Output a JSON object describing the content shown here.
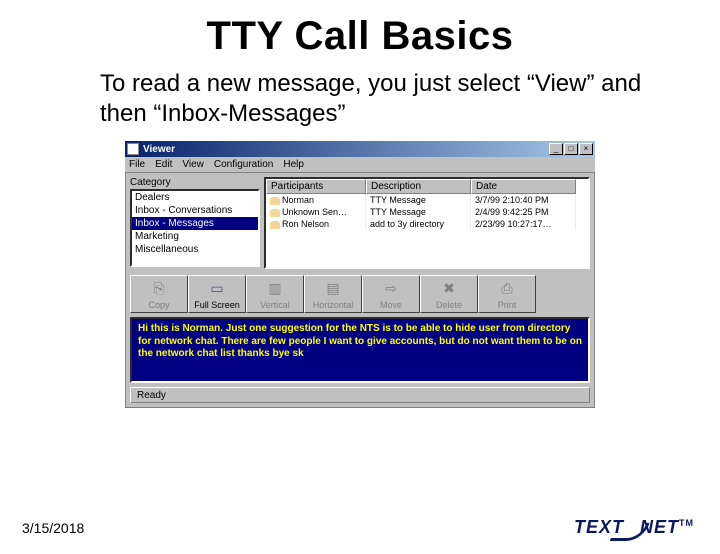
{
  "slide": {
    "title": "TTY Call Basics",
    "body": "To read a new message, you just select “View” and then “Inbox-Messages”"
  },
  "window": {
    "title": "Viewer",
    "controls": {
      "min": "_",
      "max": "□",
      "close": "×"
    }
  },
  "menu": {
    "items": [
      "File",
      "Edit",
      "View",
      "Configuration",
      "Help"
    ]
  },
  "category": {
    "label": "Category",
    "items": [
      {
        "label": "Dealers",
        "selected": false
      },
      {
        "label": "Inbox - Conversations",
        "selected": false
      },
      {
        "label": "Inbox - Messages",
        "selected": true
      },
      {
        "label": "Marketing",
        "selected": false
      },
      {
        "label": "Miscellaneous",
        "selected": false
      }
    ]
  },
  "grid": {
    "headers": {
      "participants": "Participants",
      "description": "Description",
      "date": "Date"
    },
    "rows": [
      {
        "participant": "Norman",
        "description": "TTY Message",
        "date": "3/7/99 2:10:40 PM"
      },
      {
        "participant": "Unknown Sen…",
        "description": "TTY Message",
        "date": "2/4/99 9:42:25 PM"
      },
      {
        "participant": "Ron Nelson",
        "description": "add to 3y directory",
        "date": "2/23/99 10:27:17…"
      }
    ]
  },
  "toolbar": {
    "buttons": [
      {
        "label": "Copy",
        "glyph": "⎘",
        "enabled": false
      },
      {
        "label": "Full Screen",
        "glyph": "▭",
        "enabled": true
      },
      {
        "label": "Vertical",
        "glyph": "▥",
        "enabled": false
      },
      {
        "label": "Horizontal",
        "glyph": "▤",
        "enabled": false
      },
      {
        "label": "Move",
        "glyph": "⇨",
        "enabled": false
      },
      {
        "label": "Delete",
        "glyph": "✖",
        "enabled": false
      },
      {
        "label": "Print",
        "glyph": "⎙",
        "enabled": false
      }
    ]
  },
  "message": {
    "text": "Hi this is Norman. Just one suggestion for the NTS is to be able to hide user from directory for network chat. There are few people I want to give accounts, but do not want them to be on the network chat list thanks bye sk"
  },
  "status": {
    "text": "Ready"
  },
  "footer": {
    "date": "3/15/2018"
  },
  "logo": {
    "text1": "TEXT",
    "text2": "NET",
    "tm": "TM"
  }
}
